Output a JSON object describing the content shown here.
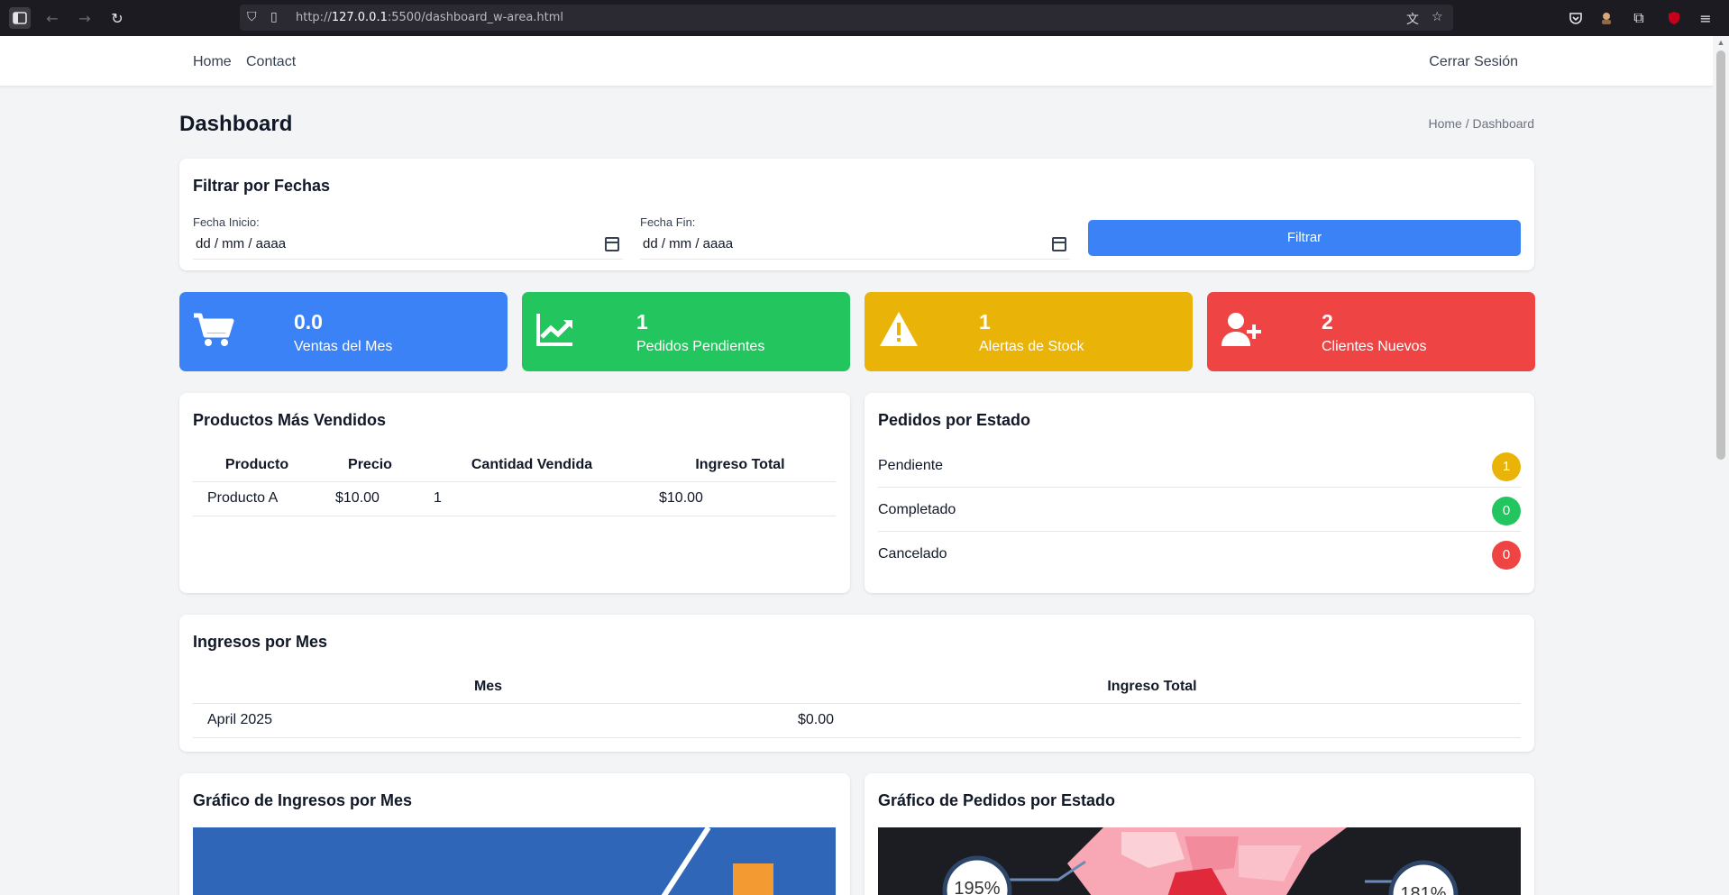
{
  "browser": {
    "url_prefix": "http://",
    "url_host": "127.0.0.1",
    "url_rest": ":5500/dashboard_w-area.html"
  },
  "nav": {
    "home": "Home",
    "contact": "Contact",
    "logout": "Cerrar Sesión"
  },
  "page": {
    "title": "Dashboard",
    "breadcrumb": "Home / Dashboard"
  },
  "filter": {
    "title": "Filtrar por Fechas",
    "start_label": "Fecha Inicio:",
    "start_value": "dd / mm / aaaa",
    "end_label": "Fecha Fin:",
    "end_value": "dd / mm / aaaa",
    "button": "Filtrar"
  },
  "stats": [
    {
      "value": "0.0",
      "label": "Ventas del Mes",
      "color": "#3b82f6",
      "icon": "cart-icon"
    },
    {
      "value": "1",
      "label": "Pedidos Pendientes",
      "color": "#22c55e",
      "icon": "chart-line-icon"
    },
    {
      "value": "1",
      "label": "Alertas de Stock",
      "color": "#eab308",
      "icon": "warning-icon"
    },
    {
      "value": "2",
      "label": "Clientes Nuevos",
      "color": "#ef4444",
      "icon": "user-plus-icon"
    }
  ],
  "top_products": {
    "title": "Productos Más Vendidos",
    "headers": [
      "Producto",
      "Precio",
      "Cantidad Vendida",
      "Ingreso Total"
    ],
    "rows": [
      [
        "Producto A",
        "$10.00",
        "1",
        "$10.00"
      ]
    ]
  },
  "orders_by_status": {
    "title": "Pedidos por Estado",
    "items": [
      {
        "label": "Pendiente",
        "count": "1",
        "color": "#eab308"
      },
      {
        "label": "Completado",
        "count": "0",
        "color": "#22c55e"
      },
      {
        "label": "Cancelado",
        "count": "0",
        "color": "#ef4444"
      }
    ]
  },
  "monthly_income": {
    "title": "Ingresos por Mes",
    "headers": [
      "Mes",
      "Ingreso Total"
    ],
    "rows": [
      [
        "April 2025",
        "$0.00"
      ]
    ]
  },
  "income_chart": {
    "title": "Gráfico de Ingresos por Mes"
  },
  "status_chart": {
    "title": "Gráfico de Pedidos por Estado",
    "labels": [
      "195%",
      "181%"
    ]
  }
}
